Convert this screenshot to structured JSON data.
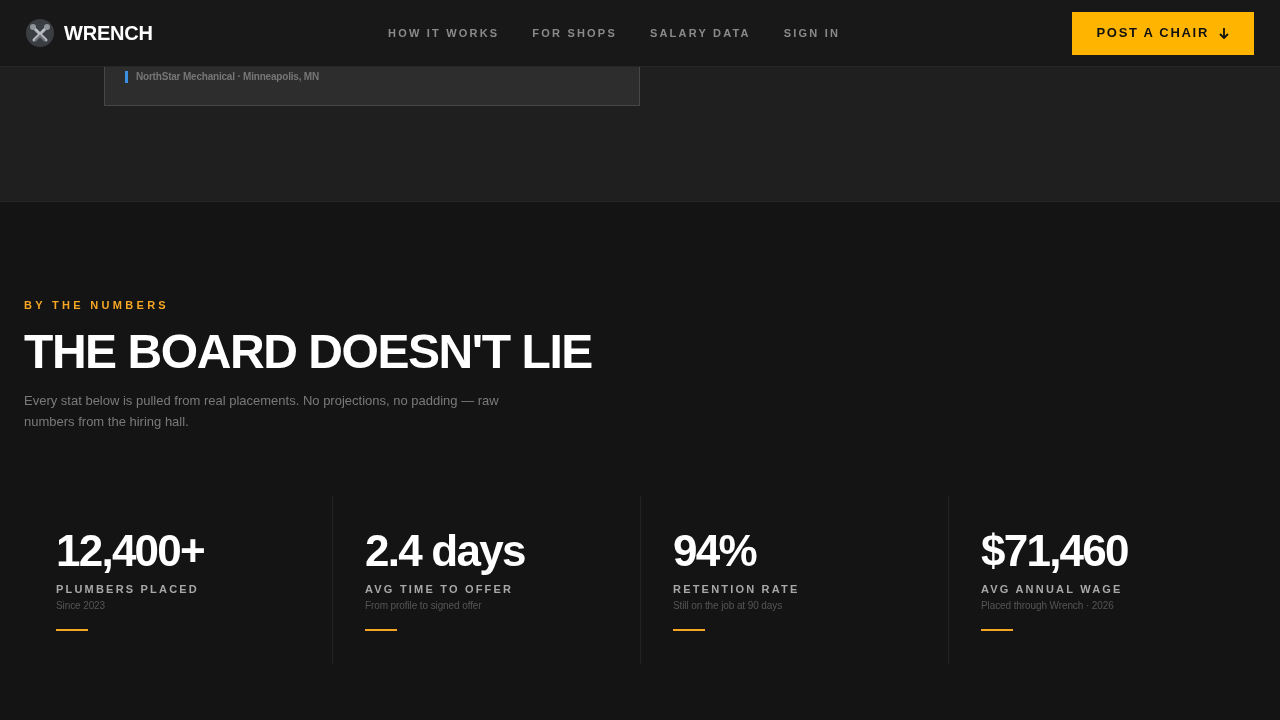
{
  "header": {
    "brand": "WRENCH",
    "nav": [
      "HOW IT WORKS",
      "FOR SHOPS",
      "SALARY DATA",
      "SIGN IN"
    ],
    "cta": {
      "label": "POST A CHAIR"
    }
  },
  "previous_section": {
    "card": {
      "footer": "NorthStar Mechanical · Minneapolis, MN"
    }
  },
  "numbers_section": {
    "eyebrow": "BY THE NUMBERS",
    "title": "THE BOARD DOESN'T LIE",
    "intro": "Every stat below is pulled from real placements. No projections, no padding — raw numbers from the hiring hall.",
    "stats": [
      {
        "value": "12,400+",
        "label": "PLUMBERS PLACED",
        "note": "Since 2023"
      },
      {
        "value": "2.4 days",
        "label": "AVG TIME TO OFFER",
        "note": "From profile to signed offer"
      },
      {
        "value": "94%",
        "label": "RETENTION RATE",
        "note": "Still on the job at 90 days"
      },
      {
        "value": "$71,460",
        "label": "AVG ANNUAL WAGE",
        "note": "Placed through Wrench · 2026"
      }
    ]
  }
}
